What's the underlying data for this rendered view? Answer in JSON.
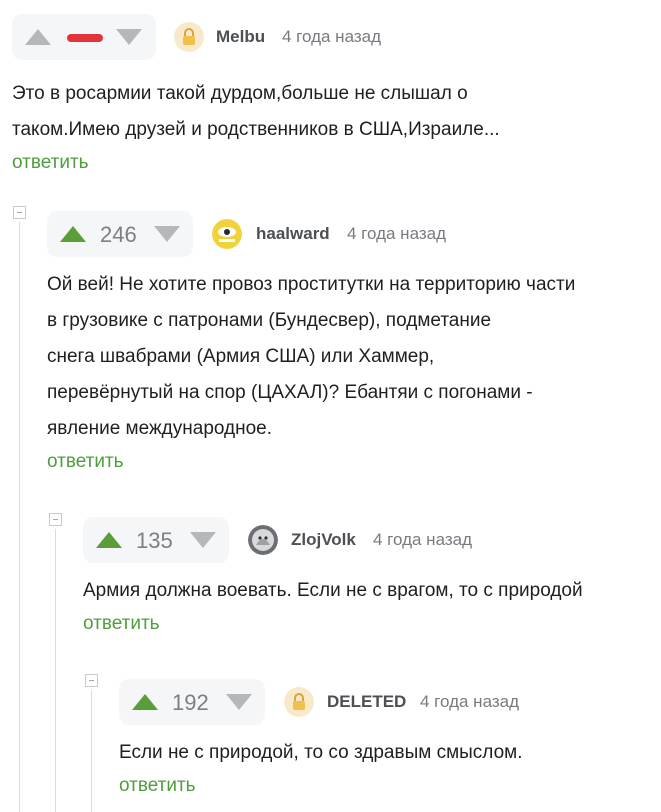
{
  "comments": [
    {
      "nick": "Melbu",
      "time": "4 года назад",
      "score": "",
      "text_lines": [
        "Это в росармии такой дурдом,больше не слышал о",
        "таком.Имею друзей и родственников в США,Израиле..."
      ],
      "reply_label": "ответить"
    },
    {
      "nick": "haalward",
      "time": "4 года назад",
      "score": "246",
      "text_lines": [
        "Ой вей! Не хотите провоз проститутки на территорию части",
        "в грузовике с патронами (Бундесвер), подметание",
        "снега швабрами (Армия США) или Хаммер,",
        "перевёрнутый на спор (ЦАХАЛ)? Ебантяи с погонами -",
        "явление международное."
      ],
      "reply_label": "ответить"
    },
    {
      "nick": "ZlojVolk",
      "time": "4 года назад",
      "score": "135",
      "text_lines": [
        "Армия должна воевать. Если не с врагом, то с природой"
      ],
      "reply_label": "ответить"
    },
    {
      "nick": "DELETED",
      "time": "4 года назад",
      "score": "192",
      "text_lines": [
        "Если не с природой, то со здравым смыслом."
      ],
      "reply_label": "ответить"
    }
  ],
  "colors": {
    "upvote_active": "#5a9e39",
    "downvote_marker": "#e0353b",
    "reply_link": "#4f9e3d"
  }
}
